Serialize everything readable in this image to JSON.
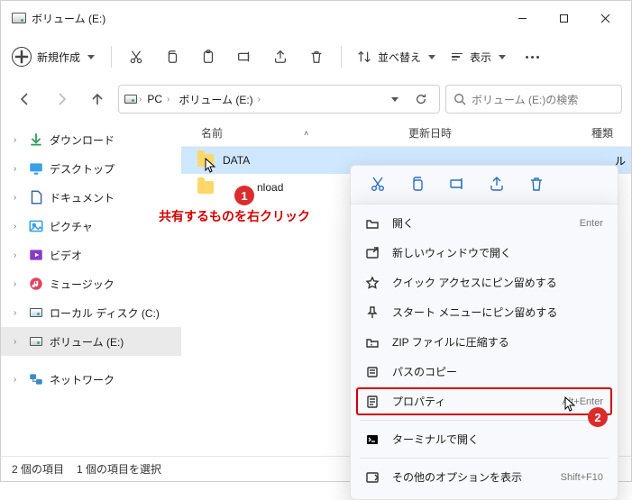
{
  "window": {
    "title": "ボリューム (E:)"
  },
  "toolbar": {
    "new_label": "新規作成",
    "sort_label": "並べ替え",
    "view_label": "表示"
  },
  "breadcrumb": {
    "pc": "PC",
    "vol": "ボリューム (E:)"
  },
  "search": {
    "placeholder": "ボリューム (E:)の検索"
  },
  "columns": {
    "name": "名前",
    "date": "更新日時",
    "type": "種類"
  },
  "rows": [
    {
      "name": "DATA"
    },
    {
      "name": "Download"
    }
  ],
  "row_truncated": "ル",
  "sidebar": {
    "items": [
      {
        "label": "ダウンロード"
      },
      {
        "label": "デスクトップ"
      },
      {
        "label": "ドキュメント"
      },
      {
        "label": "ピクチャ"
      },
      {
        "label": "ビデオ"
      },
      {
        "label": "ミュージック"
      },
      {
        "label": "ローカル ディスク (C:)"
      },
      {
        "label": "ボリューム (E:)"
      },
      {
        "label": "ネットワーク"
      }
    ]
  },
  "status": {
    "count": "2 個の項目",
    "selected": "1 個の項目を選択"
  },
  "annotation": {
    "hint": "共有するものを右クリック",
    "b1": "1",
    "b2": "2"
  },
  "ctx": {
    "open": "開く",
    "open_sc": "Enter",
    "newwin": "新しいウィンドウで開く",
    "pin_quick": "クイック アクセスにピン留めする",
    "pin_start": "スタート メニューにピン留めする",
    "zip": "ZIP ファイルに圧縮する",
    "copypath": "パスのコピー",
    "prop": "プロパティ",
    "prop_sc": "Alt+Enter",
    "terminal": "ターミナルで開く",
    "more": "その他のオプションを表示",
    "more_sc": "Shift+F10"
  }
}
